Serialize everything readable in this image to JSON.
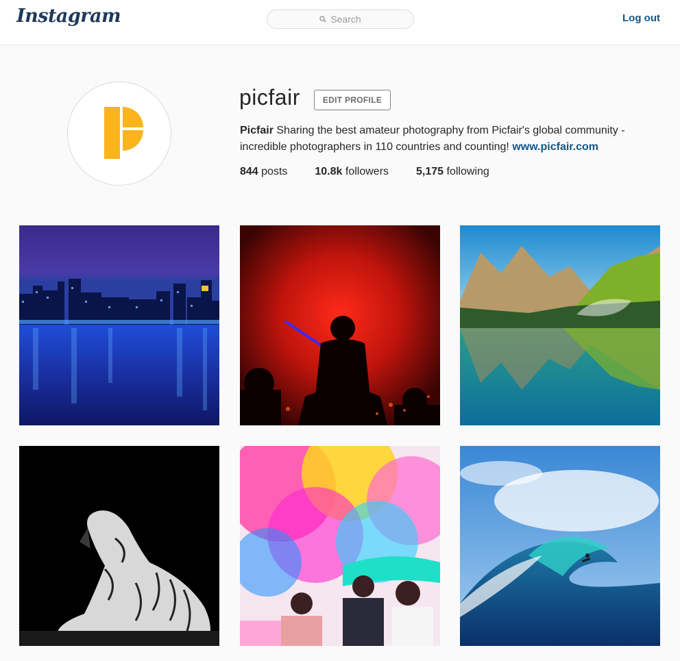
{
  "header": {
    "logo_text": "Instagram",
    "search_placeholder": "Search",
    "logout_label": "Log out"
  },
  "profile": {
    "username": "picfair",
    "edit_label": "EDIT PROFILE",
    "bio_name": "Picfair",
    "bio_text": " Sharing the best amateur photography from Picfair's global community - incredible photographers in 110 countries and counting! ",
    "bio_link": "www.picfair.com",
    "stats": {
      "posts_count": "844",
      "posts_label": " posts",
      "followers_count": "10.8k",
      "followers_label": " followers",
      "following_count": "5,175",
      "following_label": " following"
    },
    "avatar_color": "#fbb41c"
  },
  "colors": {
    "link": "#125688",
    "logo": "#1f3a5a"
  },
  "photos": [
    {
      "subject": "city-skyline-night"
    },
    {
      "subject": "silhouette-red-concert"
    },
    {
      "subject": "mountain-lake-reflection"
    },
    {
      "subject": "white-tiger-black-white"
    },
    {
      "subject": "color-powder-festival"
    },
    {
      "subject": "ocean-wave-surfer"
    }
  ]
}
